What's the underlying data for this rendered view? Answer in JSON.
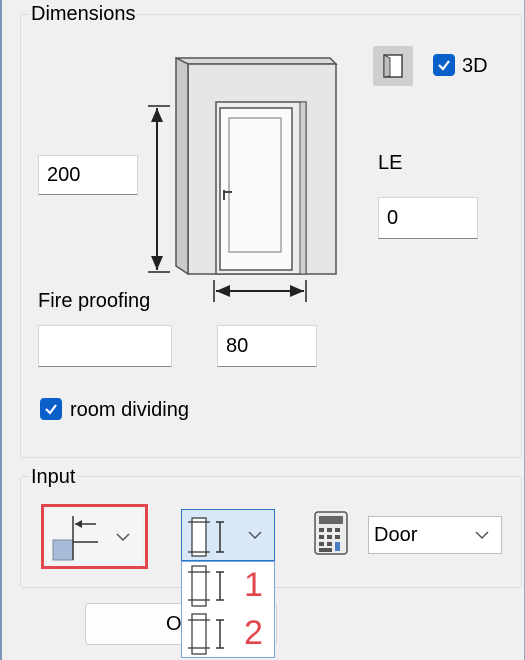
{
  "dimensions": {
    "title": "Dimensions",
    "height_value": "200",
    "width_value": "80",
    "le_label": "LE",
    "le_value": "0",
    "fire_proofing_label": "Fire proofing",
    "fire_proofing_value": "",
    "three_d_label": "3D",
    "three_d_checked": true,
    "room_dividing_label": "room dividing",
    "room_dividing_checked": true
  },
  "input": {
    "title": "Input",
    "type_select_value": "Door",
    "dropdown_items": [
      "1",
      "2"
    ]
  },
  "footer": {
    "button_label": "O"
  },
  "colors": {
    "accent": "#0a5fc9",
    "highlight": "#e0474c"
  }
}
